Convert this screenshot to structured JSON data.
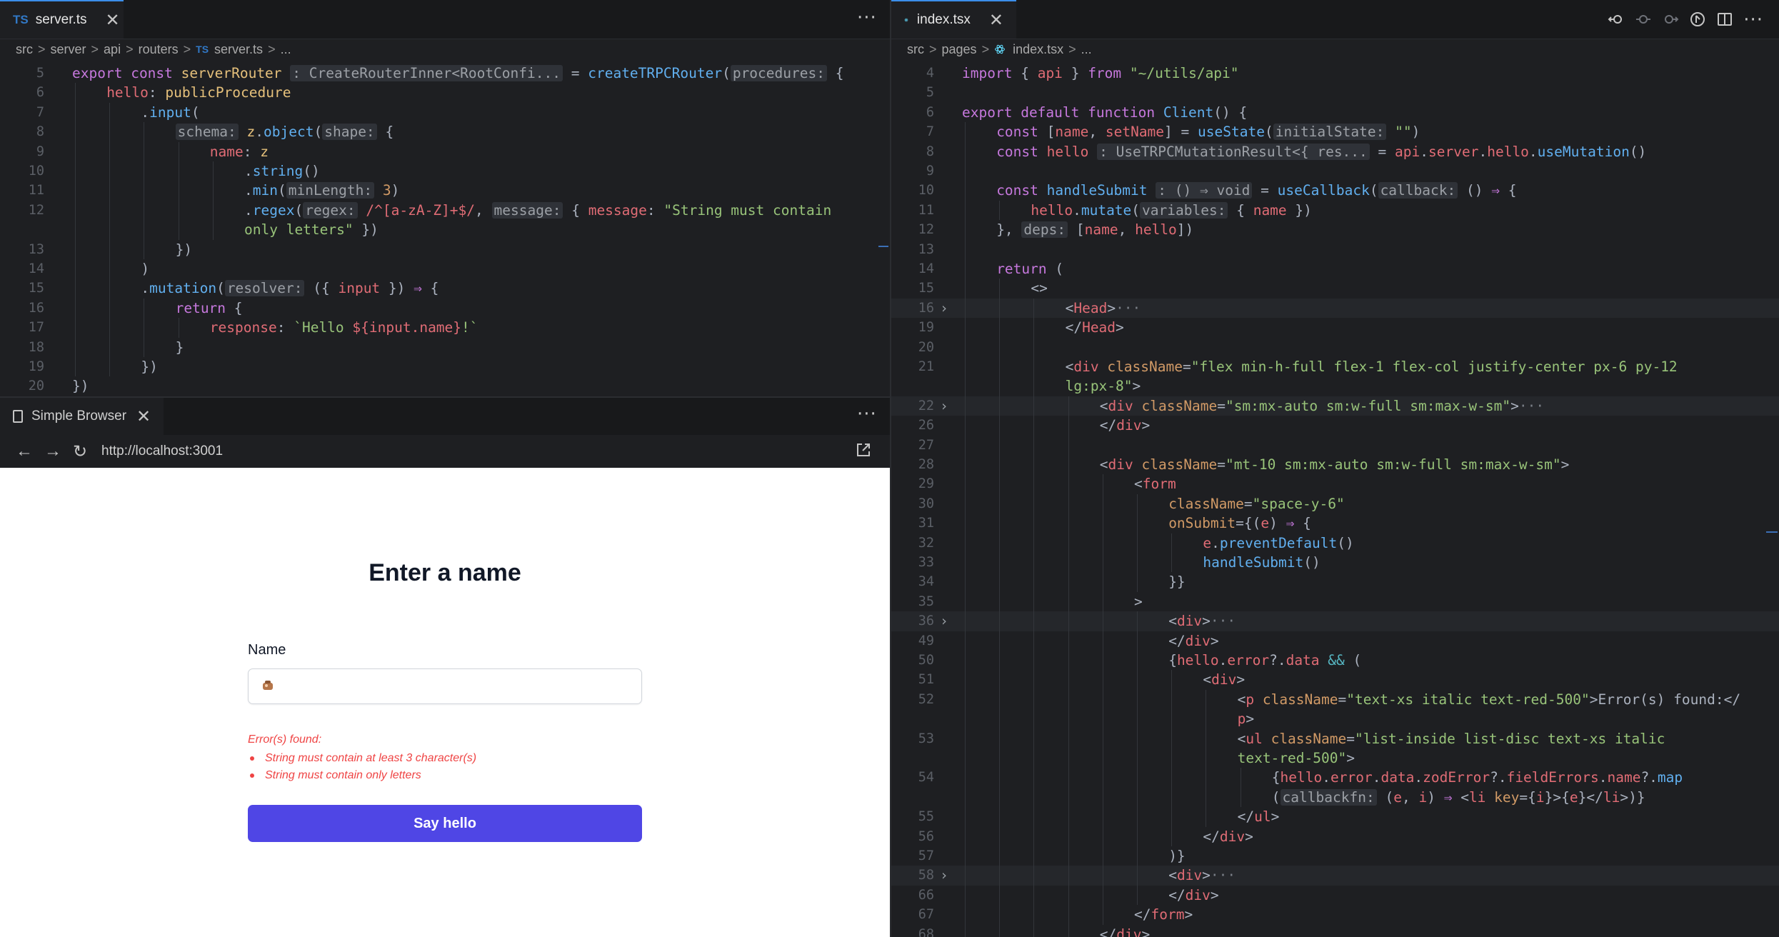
{
  "left_editor": {
    "tab": {
      "label": "server.ts",
      "lang": "TS",
      "close": "✕"
    },
    "more": "···",
    "breadcrumb": [
      "src",
      "server",
      "api",
      "routers",
      "server.ts",
      "..."
    ],
    "lines": [
      {
        "n": "5",
        "html": "<span class='kw'>export</span> <span class='kw'>const</span> <span class='ty'>serverRouter</span> <span class='hint'>: CreateRouterInner&lt;RootConfi...</span> <span class='pun'>=</span> <span class='fn'>createTRPCRouter</span><span class='pun'>(</span><span class='hint'>procedures:</span> <span class='pun'>{</span>",
        "indent": 0
      },
      {
        "n": "6",
        "html": "<span class='var'>hello</span><span class='pun'>:</span> <span class='ty'>publicProcedure</span>",
        "indent": 1
      },
      {
        "n": "7",
        "html": "<span class='pun'>.</span><span class='fn'>input</span><span class='pun'>(</span>",
        "indent": 2
      },
      {
        "n": "8",
        "html": "<span class='hint'>schema:</span> <span class='ty'>z</span><span class='pun'>.</span><span class='fn'>object</span><span class='pun'>(</span><span class='hint'>shape:</span> <span class='pun'>{</span>",
        "indent": 3
      },
      {
        "n": "9",
        "html": "<span class='var'>name</span><span class='pun'>:</span> <span class='ty'>z</span>",
        "indent": 4
      },
      {
        "n": "10",
        "html": "<span class='pun'>.</span><span class='fn'>string</span><span class='pun'>()</span>",
        "indent": 5
      },
      {
        "n": "11",
        "html": "<span class='pun'>.</span><span class='fn'>min</span><span class='pun'>(</span><span class='hint'>minLength:</span> <span class='num'>3</span><span class='pun'>)</span>",
        "indent": 5
      },
      {
        "n": "12",
        "html": "<span class='pun'>.</span><span class='fn'>regex</span><span class='pun'>(</span><span class='hint'>regex:</span> <span class='var'>/^[a-zA-Z]+$/</span><span class='pun'>,</span> <span class='hint'>message:</span> <span class='pun'>{</span> <span class='var'>message</span><span class='pun'>:</span> <span class='str'>\"String must contain</span>",
        "indent": 5
      },
      {
        "n": "",
        "html": "<span class='str'>only letters\"</span> <span class='pun'>})</span>",
        "indent": 5
      },
      {
        "n": "13",
        "html": "<span class='pun'>})</span>",
        "indent": 3
      },
      {
        "n": "14",
        "html": "<span class='pun'>)</span>",
        "indent": 2
      },
      {
        "n": "15",
        "html": "<span class='pun'>.</span><span class='fn'>mutation</span><span class='pun'>(</span><span class='hint'>resolver:</span> <span class='pun'>({</span> <span class='var'>input</span> <span class='pun'>})</span> <span class='kw'>⇒</span> <span class='pun'>{</span>",
        "indent": 2
      },
      {
        "n": "16",
        "html": "<span class='kw'>return</span> <span class='pun'>{</span>",
        "indent": 3
      },
      {
        "n": "17",
        "html": "<span class='var'>response</span><span class='pun'>:</span> <span class='str'>`Hello </span><span class='var'>${input.name}</span><span class='str'>!`</span>",
        "indent": 4
      },
      {
        "n": "18",
        "html": "<span class='pun'>}</span>",
        "indent": 3
      },
      {
        "n": "19",
        "html": "<span class='pun'>})</span>",
        "indent": 2
      },
      {
        "n": "20",
        "html": "<span class='pun'>})</span>",
        "indent": 0
      }
    ]
  },
  "browser": {
    "tab": {
      "label": "Simple Browser",
      "close": "✕"
    },
    "more": "···",
    "url": "http://localhost:3001",
    "page": {
      "title": "Enter a name",
      "field_label": "Name",
      "input_value": "",
      "error_title": "Error(s) found:",
      "errors": [
        "String must contain at least 3 character(s)",
        "String must contain only letters"
      ],
      "button": "Say hello"
    }
  },
  "right_editor": {
    "tab": {
      "label": "index.tsx",
      "close": "✕"
    },
    "breadcrumb": [
      "src",
      "pages",
      "index.tsx",
      "..."
    ],
    "lines": [
      {
        "n": "4",
        "html": "<span class='kw'>import</span> <span class='pun'>{</span> <span class='var'>api</span> <span class='pun'>}</span> <span class='kw'>from</span> <span class='str'>\"~/utils/api\"</span>",
        "indent": 0
      },
      {
        "n": "5",
        "html": "",
        "indent": 0
      },
      {
        "n": "6",
        "html": "<span class='kw'>export</span> <span class='kw'>default</span> <span class='kw'>function</span> <span class='fn'>Client</span><span class='pun'>()</span> <span class='pun'>{</span>",
        "indent": 0
      },
      {
        "n": "7",
        "html": "<span class='kw'>const</span> <span class='pun'>[</span><span class='var'>name</span><span class='pun'>,</span> <span class='var'>setName</span><span class='pun'>]</span> <span class='pun'>=</span> <span class='fn'>useState</span><span class='pun'>(</span><span class='hint'>initialState:</span> <span class='str'>\"\"</span><span class='pun'>)</span>",
        "indent": 1
      },
      {
        "n": "8",
        "html": "<span class='kw'>const</span> <span class='var'>hello</span> <span class='hint'>: UseTRPCMutationResult&lt;{ res...</span> <span class='pun'>=</span> <span class='var'>api</span><span class='pun'>.</span><span class='var'>server</span><span class='pun'>.</span><span class='var'>hello</span><span class='pun'>.</span><span class='fn'>useMutation</span><span class='pun'>()</span>",
        "indent": 1
      },
      {
        "n": "9",
        "html": "",
        "indent": 1
      },
      {
        "n": "10",
        "html": "<span class='kw'>const</span> <span class='fn'>handleSubmit</span> <span class='hint'>: () ⇒ void</span> <span class='pun'>=</span> <span class='fn'>useCallback</span><span class='pun'>(</span><span class='hint'>callback:</span> <span class='pun'>()</span> <span class='kw'>⇒</span> <span class='pun'>{</span>",
        "indent": 1
      },
      {
        "n": "11",
        "html": "<span class='var'>hello</span><span class='pun'>.</span><span class='fn'>mutate</span><span class='pun'>(</span><span class='hint'>variables:</span> <span class='pun'>{</span> <span class='var'>name</span> <span class='pun'>})</span>",
        "indent": 2
      },
      {
        "n": "12",
        "html": "<span class='pun'>},</span> <span class='hint'>deps:</span> <span class='pun'>[</span><span class='var'>name</span><span class='pun'>,</span> <span class='var'>hello</span><span class='pun'>])</span>",
        "indent": 1
      },
      {
        "n": "13",
        "html": "",
        "indent": 1
      },
      {
        "n": "14",
        "html": "<span class='kw'>return</span> <span class='pun'>(</span>",
        "indent": 1
      },
      {
        "n": "15",
        "html": "<span class='pun'>&lt;&gt;</span>",
        "indent": 2
      },
      {
        "n": "16",
        "html": "<span class='pun'>&lt;</span><span class='var'>Head</span><span class='pun'>&gt;</span><span class='fold'>···</span>",
        "indent": 3,
        "fold": true
      },
      {
        "n": "19",
        "html": "<span class='pun'>&lt;/</span><span class='var'>Head</span><span class='pun'>&gt;</span>",
        "indent": 3
      },
      {
        "n": "20",
        "html": "",
        "indent": 3
      },
      {
        "n": "21",
        "html": "<span class='pun'>&lt;</span><span class='var'>div</span> <span class='num'>className</span><span class='pun'>=</span><span class='str'>\"flex min-h-full flex-1 flex-col justify-center px-6 py-12</span>",
        "indent": 3
      },
      {
        "n": "",
        "html": "<span class='str'>lg:px-8\"</span><span class='pun'>&gt;</span>",
        "indent": 3
      },
      {
        "n": "22",
        "html": "<span class='pun'>&lt;</span><span class='var'>div</span> <span class='num'>className</span><span class='pun'>=</span><span class='str'>\"sm:mx-auto sm:w-full sm:max-w-sm\"</span><span class='pun'>&gt;</span><span class='fold'>···</span>",
        "indent": 4,
        "fold": true
      },
      {
        "n": "26",
        "html": "<span class='pun'>&lt;/</span><span class='var'>div</span><span class='pun'>&gt;</span>",
        "indent": 4
      },
      {
        "n": "27",
        "html": "",
        "indent": 4
      },
      {
        "n": "28",
        "html": "<span class='pun'>&lt;</span><span class='var'>div</span> <span class='num'>className</span><span class='pun'>=</span><span class='str'>\"mt-10 sm:mx-auto sm:w-full sm:max-w-sm\"</span><span class='pun'>&gt;</span>",
        "indent": 4
      },
      {
        "n": "29",
        "html": "<span class='pun'>&lt;</span><span class='var'>form</span>",
        "indent": 5
      },
      {
        "n": "30",
        "html": "<span class='num'>className</span><span class='pun'>=</span><span class='str'>\"space-y-6\"</span>",
        "indent": 6
      },
      {
        "n": "31",
        "html": "<span class='num'>onSubmit</span><span class='pun'>={(</span><span class='var'>e</span><span class='pun'>)</span> <span class='kw'>⇒</span> <span class='pun'>{</span>",
        "indent": 6
      },
      {
        "n": "32",
        "html": "<span class='var'>e</span><span class='pun'>.</span><span class='fn'>preventDefault</span><span class='pun'>()</span>",
        "indent": 7
      },
      {
        "n": "33",
        "html": "<span class='fn'>handleSubmit</span><span class='pun'>()</span>",
        "indent": 7
      },
      {
        "n": "34",
        "html": "<span class='pun'>}}</span>",
        "indent": 6
      },
      {
        "n": "35",
        "html": "<span class='pun'>&gt;</span>",
        "indent": 5
      },
      {
        "n": "36",
        "html": "<span class='pun'>&lt;</span><span class='var'>div</span><span class='pun'>&gt;</span><span class='fold'>···</span>",
        "indent": 6,
        "fold": true
      },
      {
        "n": "49",
        "html": "<span class='pun'>&lt;/</span><span class='var'>div</span><span class='pun'>&gt;</span>",
        "indent": 6
      },
      {
        "n": "50",
        "html": "<span class='pun'>{</span><span class='var'>hello</span><span class='pun'>.</span><span class='var'>error</span><span class='pun'>?.</span><span class='var'>data</span> <span class='cyan'>&amp;&amp;</span> <span class='pun'>(</span>",
        "indent": 6
      },
      {
        "n": "51",
        "html": "<span class='pun'>&lt;</span><span class='var'>div</span><span class='pun'>&gt;</span>",
        "indent": 7
      },
      {
        "n": "52",
        "html": "<span class='pun'>&lt;</span><span class='var'>p</span> <span class='num'>className</span><span class='pun'>=</span><span class='str'>\"text-xs italic text-red-500\"</span><span class='pun'>&gt;Error(s) found:&lt;/</span>",
        "indent": 8
      },
      {
        "n": "",
        "html": "<span class='var'>p</span><span class='pun'>&gt;</span>",
        "indent": 8
      },
      {
        "n": "53",
        "html": "<span class='pun'>&lt;</span><span class='var'>ul</span> <span class='num'>className</span><span class='pun'>=</span><span class='str'>\"list-inside list-disc text-xs italic</span>",
        "indent": 8
      },
      {
        "n": "",
        "html": "<span class='str'>text-red-500\"</span><span class='pun'>&gt;</span>",
        "indent": 8
      },
      {
        "n": "54",
        "html": "<span class='pun'>{</span><span class='var'>hello</span><span class='pun'>.</span><span class='var'>error</span><span class='pun'>.</span><span class='var'>data</span><span class='pun'>.</span><span class='var'>zodError</span><span class='pun'>?.</span><span class='var'>fieldErrors</span><span class='pun'>.</span><span class='var'>name</span><span class='pun'>?.</span><span class='fn'>map</span>",
        "indent": 9
      },
      {
        "n": "",
        "html": "<span class='pun'>(</span><span class='hint'>callbackfn:</span> <span class='pun'>(</span><span class='var'>e</span><span class='pun'>,</span> <span class='var'>i</span><span class='pun'>)</span> <span class='kw'>⇒</span> <span class='pun'>&lt;</span><span class='var'>li</span> <span class='num'>key</span><span class='pun'>={</span><span class='var'>i</span><span class='pun'>}&gt;{</span><span class='var'>e</span><span class='pun'>}&lt;/</span><span class='var'>li</span><span class='pun'>&gt;)}</span>",
        "indent": 9
      },
      {
        "n": "55",
        "html": "<span class='pun'>&lt;/</span><span class='var'>ul</span><span class='pun'>&gt;</span>",
        "indent": 8
      },
      {
        "n": "56",
        "html": "<span class='pun'>&lt;/</span><span class='var'>div</span><span class='pun'>&gt;</span>",
        "indent": 7
      },
      {
        "n": "57",
        "html": "<span class='pun'>)}</span>",
        "indent": 6
      },
      {
        "n": "58",
        "html": "<span class='pun'>&lt;</span><span class='var'>div</span><span class='pun'>&gt;</span><span class='fold'>···</span>",
        "indent": 6,
        "fold": true
      },
      {
        "n": "66",
        "html": "<span class='pun'>&lt;/</span><span class='var'>div</span><span class='pun'>&gt;</span>",
        "indent": 6
      },
      {
        "n": "67",
        "html": "<span class='pun'>&lt;/</span><span class='var'>form</span><span class='pun'>&gt;</span>",
        "indent": 5
      },
      {
        "n": "68",
        "html": "<span class='pun'>&lt;/</span><span class='var'>div</span><span class='pun'>&gt;</span>",
        "indent": 4
      }
    ]
  },
  "colors": {
    "accent": "#3b8eea",
    "button": "#4f46e5",
    "error": "#ef4444"
  },
  "icons": [
    "typescript-icon",
    "react-icon",
    "close-icon",
    "more-icon",
    "back-icon",
    "forward-icon",
    "reload-icon",
    "open-external-icon",
    "document-icon",
    "git-compare-icon",
    "split-editor-icon"
  ]
}
